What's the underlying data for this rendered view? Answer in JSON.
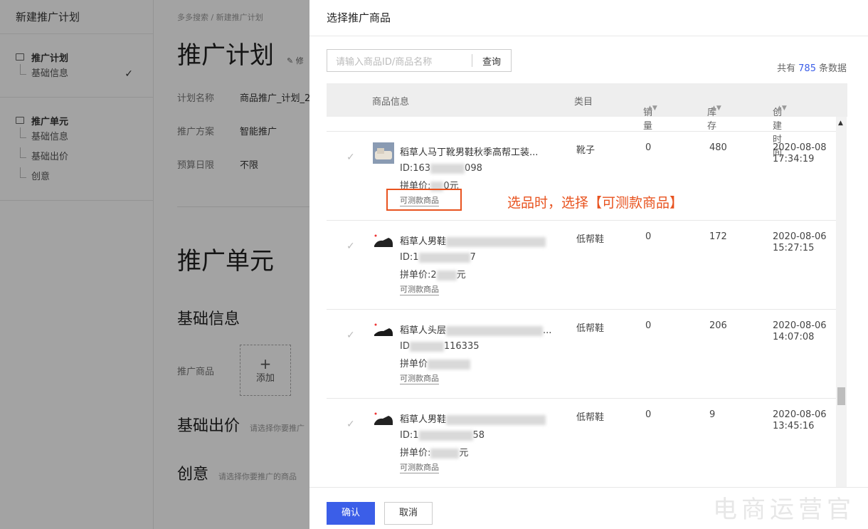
{
  "sidebar": {
    "title": "新建推广计划",
    "groups": [
      {
        "label": "推广计划",
        "items": [
          "基础信息"
        ]
      },
      {
        "label": "推广单元",
        "items": [
          "基础信息",
          "基础出价",
          "创意"
        ]
      }
    ]
  },
  "main": {
    "breadcrumb": "多多搜索 / 新建推广计划",
    "plan_title": "推广计划",
    "edit_label": "修",
    "fields": [
      {
        "label": "计划名称",
        "value": "商品推广_计划_2"
      },
      {
        "label": "推广方案",
        "value": "智能推广"
      },
      {
        "label": "预算日限",
        "value": "不限"
      }
    ],
    "unit_title": "推广单元",
    "basic_info": "基础信息",
    "product_label": "推广商品",
    "add_plus": "+",
    "add_label": "添加",
    "bid_title": "基础出价",
    "bid_hint": "请选择你要推广",
    "creative_title": "创意",
    "creative_hint": "请选择你要推广的商品"
  },
  "drawer": {
    "title": "选择推广商品",
    "search_placeholder": "请输入商品ID/商品名称",
    "search_button": "查询",
    "total_prefix": "共有",
    "total_count": "785",
    "total_suffix": "条数据",
    "columns": [
      "商品信息",
      "类目",
      "销量",
      "库存",
      "创建时间"
    ],
    "sort_icon": "▲▼",
    "rows": [
      {
        "name": "稻草人马丁靴男鞋秋季高帮工装...",
        "id_prefix": "ID:163",
        "id_suffix": "098",
        "price_prefix": "拼单价:",
        "price_suffix": "0元",
        "tag": "可测款商品",
        "category": "靴子",
        "sales": "0",
        "stock": "480",
        "created_date": "2020-08-08",
        "created_time": "17:34:19"
      },
      {
        "name": "稻草人男鞋",
        "id_prefix": "ID:1",
        "id_suffix": "7",
        "price_prefix": "拼单价:2",
        "price_suffix": "元",
        "tag": "可测款商品",
        "category": "低帮鞋",
        "sales": "0",
        "stock": "172",
        "created_date": "2020-08-06",
        "created_time": "15:27:15"
      },
      {
        "name": "稻草人头层",
        "id_prefix": "ID",
        "id_suffix": "116335",
        "price_prefix": "拼单价",
        "price_suffix": "",
        "tag": "可测款商品",
        "category": "低帮鞋",
        "sales": "0",
        "stock": "206",
        "created_date": "2020-08-06",
        "created_time": "14:07:08"
      },
      {
        "name": "稻草人男鞋",
        "id_prefix": "ID:1",
        "id_suffix": "58",
        "price_prefix": "拼单价:",
        "price_suffix": "元",
        "tag": "可测款商品",
        "category": "低帮鞋",
        "sales": "0",
        "stock": "9",
        "created_date": "2020-08-06",
        "created_time": "13:45:16"
      }
    ],
    "annotation": "选品时，选择【可测款商品】",
    "confirm": "确认",
    "cancel": "取消"
  },
  "watermark": "电商运营官",
  "colors": {
    "primary": "#3b5ee8",
    "annotation": "#e8531f"
  }
}
